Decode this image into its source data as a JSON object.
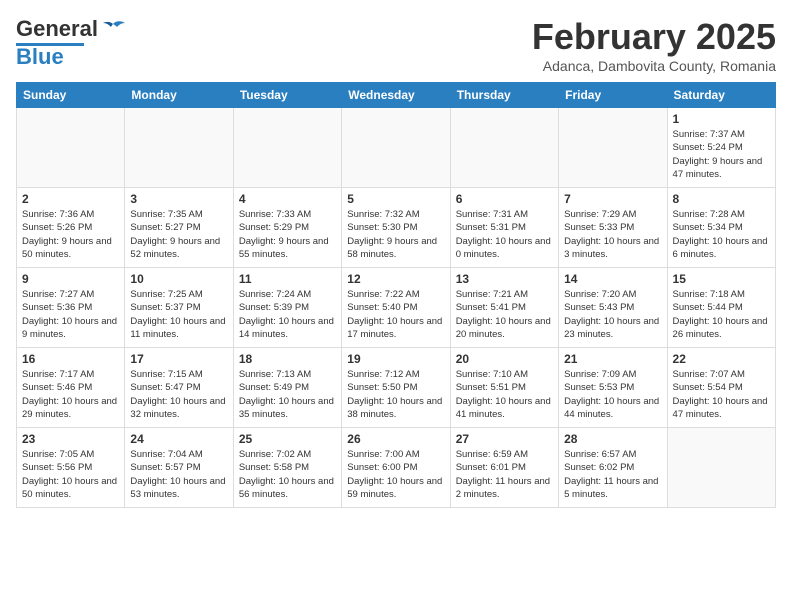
{
  "header": {
    "logo_general": "General",
    "logo_blue": "Blue",
    "month_title": "February 2025",
    "location": "Adanca, Dambovita County, Romania"
  },
  "weekdays": [
    "Sunday",
    "Monday",
    "Tuesday",
    "Wednesday",
    "Thursday",
    "Friday",
    "Saturday"
  ],
  "weeks": [
    [
      {
        "day": "",
        "info": ""
      },
      {
        "day": "",
        "info": ""
      },
      {
        "day": "",
        "info": ""
      },
      {
        "day": "",
        "info": ""
      },
      {
        "day": "",
        "info": ""
      },
      {
        "day": "",
        "info": ""
      },
      {
        "day": "1",
        "info": "Sunrise: 7:37 AM\nSunset: 5:24 PM\nDaylight: 9 hours and 47 minutes."
      }
    ],
    [
      {
        "day": "2",
        "info": "Sunrise: 7:36 AM\nSunset: 5:26 PM\nDaylight: 9 hours and 50 minutes."
      },
      {
        "day": "3",
        "info": "Sunrise: 7:35 AM\nSunset: 5:27 PM\nDaylight: 9 hours and 52 minutes."
      },
      {
        "day": "4",
        "info": "Sunrise: 7:33 AM\nSunset: 5:29 PM\nDaylight: 9 hours and 55 minutes."
      },
      {
        "day": "5",
        "info": "Sunrise: 7:32 AM\nSunset: 5:30 PM\nDaylight: 9 hours and 58 minutes."
      },
      {
        "day": "6",
        "info": "Sunrise: 7:31 AM\nSunset: 5:31 PM\nDaylight: 10 hours and 0 minutes."
      },
      {
        "day": "7",
        "info": "Sunrise: 7:29 AM\nSunset: 5:33 PM\nDaylight: 10 hours and 3 minutes."
      },
      {
        "day": "8",
        "info": "Sunrise: 7:28 AM\nSunset: 5:34 PM\nDaylight: 10 hours and 6 minutes."
      }
    ],
    [
      {
        "day": "9",
        "info": "Sunrise: 7:27 AM\nSunset: 5:36 PM\nDaylight: 10 hours and 9 minutes."
      },
      {
        "day": "10",
        "info": "Sunrise: 7:25 AM\nSunset: 5:37 PM\nDaylight: 10 hours and 11 minutes."
      },
      {
        "day": "11",
        "info": "Sunrise: 7:24 AM\nSunset: 5:39 PM\nDaylight: 10 hours and 14 minutes."
      },
      {
        "day": "12",
        "info": "Sunrise: 7:22 AM\nSunset: 5:40 PM\nDaylight: 10 hours and 17 minutes."
      },
      {
        "day": "13",
        "info": "Sunrise: 7:21 AM\nSunset: 5:41 PM\nDaylight: 10 hours and 20 minutes."
      },
      {
        "day": "14",
        "info": "Sunrise: 7:20 AM\nSunset: 5:43 PM\nDaylight: 10 hours and 23 minutes."
      },
      {
        "day": "15",
        "info": "Sunrise: 7:18 AM\nSunset: 5:44 PM\nDaylight: 10 hours and 26 minutes."
      }
    ],
    [
      {
        "day": "16",
        "info": "Sunrise: 7:17 AM\nSunset: 5:46 PM\nDaylight: 10 hours and 29 minutes."
      },
      {
        "day": "17",
        "info": "Sunrise: 7:15 AM\nSunset: 5:47 PM\nDaylight: 10 hours and 32 minutes."
      },
      {
        "day": "18",
        "info": "Sunrise: 7:13 AM\nSunset: 5:49 PM\nDaylight: 10 hours and 35 minutes."
      },
      {
        "day": "19",
        "info": "Sunrise: 7:12 AM\nSunset: 5:50 PM\nDaylight: 10 hours and 38 minutes."
      },
      {
        "day": "20",
        "info": "Sunrise: 7:10 AM\nSunset: 5:51 PM\nDaylight: 10 hours and 41 minutes."
      },
      {
        "day": "21",
        "info": "Sunrise: 7:09 AM\nSunset: 5:53 PM\nDaylight: 10 hours and 44 minutes."
      },
      {
        "day": "22",
        "info": "Sunrise: 7:07 AM\nSunset: 5:54 PM\nDaylight: 10 hours and 47 minutes."
      }
    ],
    [
      {
        "day": "23",
        "info": "Sunrise: 7:05 AM\nSunset: 5:56 PM\nDaylight: 10 hours and 50 minutes."
      },
      {
        "day": "24",
        "info": "Sunrise: 7:04 AM\nSunset: 5:57 PM\nDaylight: 10 hours and 53 minutes."
      },
      {
        "day": "25",
        "info": "Sunrise: 7:02 AM\nSunset: 5:58 PM\nDaylight: 10 hours and 56 minutes."
      },
      {
        "day": "26",
        "info": "Sunrise: 7:00 AM\nSunset: 6:00 PM\nDaylight: 10 hours and 59 minutes."
      },
      {
        "day": "27",
        "info": "Sunrise: 6:59 AM\nSunset: 6:01 PM\nDaylight: 11 hours and 2 minutes."
      },
      {
        "day": "28",
        "info": "Sunrise: 6:57 AM\nSunset: 6:02 PM\nDaylight: 11 hours and 5 minutes."
      },
      {
        "day": "",
        "info": ""
      }
    ]
  ]
}
